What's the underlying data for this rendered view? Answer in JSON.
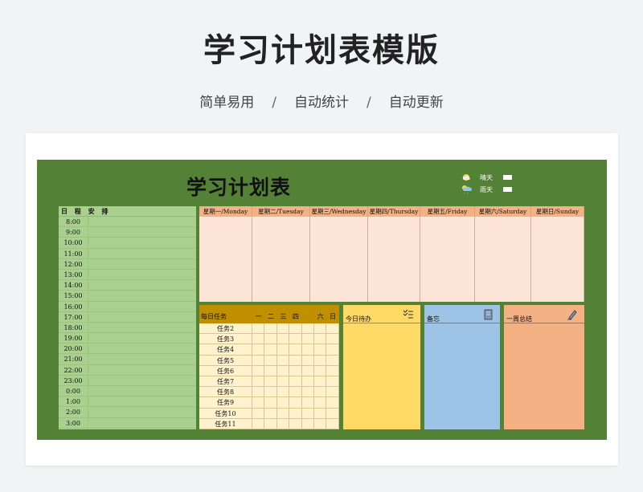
{
  "header": {
    "title": "学习计划表模版",
    "tags": [
      "简单易用",
      "自动统计",
      "自动更新"
    ],
    "separator": "/"
  },
  "sheet": {
    "title": "学习计划表",
    "legend": [
      {
        "label": "晴天",
        "icon": "sun-icon"
      },
      {
        "label": "雨天",
        "icon": "rain-icon"
      }
    ]
  },
  "schedule": {
    "header": "日 程 安 排",
    "times": [
      "8:00",
      "9:00",
      "10:00",
      "11:00",
      "12:00",
      "13:00",
      "14:00",
      "15:00",
      "16:00",
      "17:00",
      "18:00",
      "19:00",
      "20:00",
      "21:00",
      "22:00",
      "23:00",
      "0:00",
      "1:00",
      "2:00",
      "3:00"
    ]
  },
  "week": {
    "days": [
      "星期一/Monday",
      "星期二/Tuesday",
      "星期三/Wednesday",
      "星期四/Thursday",
      "星期五/Friday",
      "星期六/Saturday",
      "星期日/Sunday"
    ]
  },
  "tasks": {
    "header": "每日任务",
    "weekdays": [
      "一",
      "二",
      "三",
      "四",
      "",
      "六",
      "日"
    ],
    "items": [
      "任务2",
      "任务3",
      "任务4",
      "任务5",
      "任务6",
      "任务7",
      "任务8",
      "任务9",
      "任务10",
      "任务11"
    ]
  },
  "panels": {
    "todo": {
      "label": "今日待办",
      "icon": "checklist-icon",
      "color": "#ffd966"
    },
    "memo": {
      "label": "备忘",
      "icon": "notebook-icon",
      "color": "#9dc3e6"
    },
    "summary": {
      "label": "一周总结",
      "icon": "pen-icon",
      "color": "#f4b183"
    }
  },
  "colors": {
    "sheet_bg": "#538135",
    "schedule_bg": "#a9d08e",
    "week_header": "#f4b183",
    "week_body": "#fce4d6",
    "task_header": "#bf8f00",
    "task_body": "#fff2cc"
  }
}
